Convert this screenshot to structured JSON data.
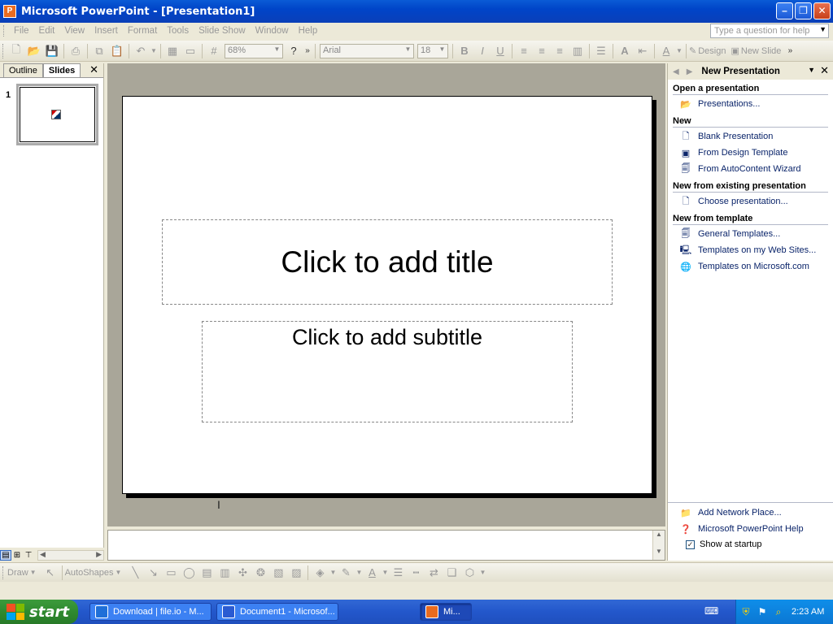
{
  "window": {
    "title": "Microsoft PowerPoint - [Presentation1]",
    "icon_label": "P"
  },
  "menu": {
    "items": [
      "File",
      "Edit",
      "View",
      "Insert",
      "Format",
      "Tools",
      "Slide Show",
      "Window",
      "Help"
    ],
    "help_placeholder": "Type a question for help"
  },
  "toolbar": {
    "zoom": "68%",
    "font": "Arial",
    "font_size": "18",
    "design_label": "Design",
    "new_slide_label": "New Slide"
  },
  "slides_pane": {
    "tabs": [
      "Outline",
      "Slides"
    ],
    "slide_number": "1"
  },
  "slide": {
    "title_placeholder": "Click to add title",
    "subtitle_placeholder": "Click to add subtitle"
  },
  "task_pane": {
    "title": "New Presentation",
    "sections": {
      "open": "Open a presentation",
      "new": "New",
      "existing": "New from existing presentation",
      "template": "New from template"
    },
    "links": {
      "presentations": "Presentations...",
      "blank": "Blank Presentation",
      "design_template": "From Design Template",
      "autocontent": "From AutoContent Wizard",
      "choose": "Choose presentation...",
      "general_templates": "General Templates...",
      "web_templates": "Templates on my Web Sites...",
      "ms_templates": "Templates on Microsoft.com",
      "network_place": "Add Network Place...",
      "ppt_help": "Microsoft PowerPoint Help",
      "show_startup": "Show at startup"
    },
    "show_at_startup_checked": true
  },
  "drawing_toolbar": {
    "draw_label": "Draw",
    "autoshapes_label": "AutoShapes"
  },
  "taskbar": {
    "start_label": "start",
    "buttons": [
      "Download | file.io - M...",
      "Document1 - Microsof...",
      "Mi..."
    ],
    "clock": "2:23 AM"
  }
}
